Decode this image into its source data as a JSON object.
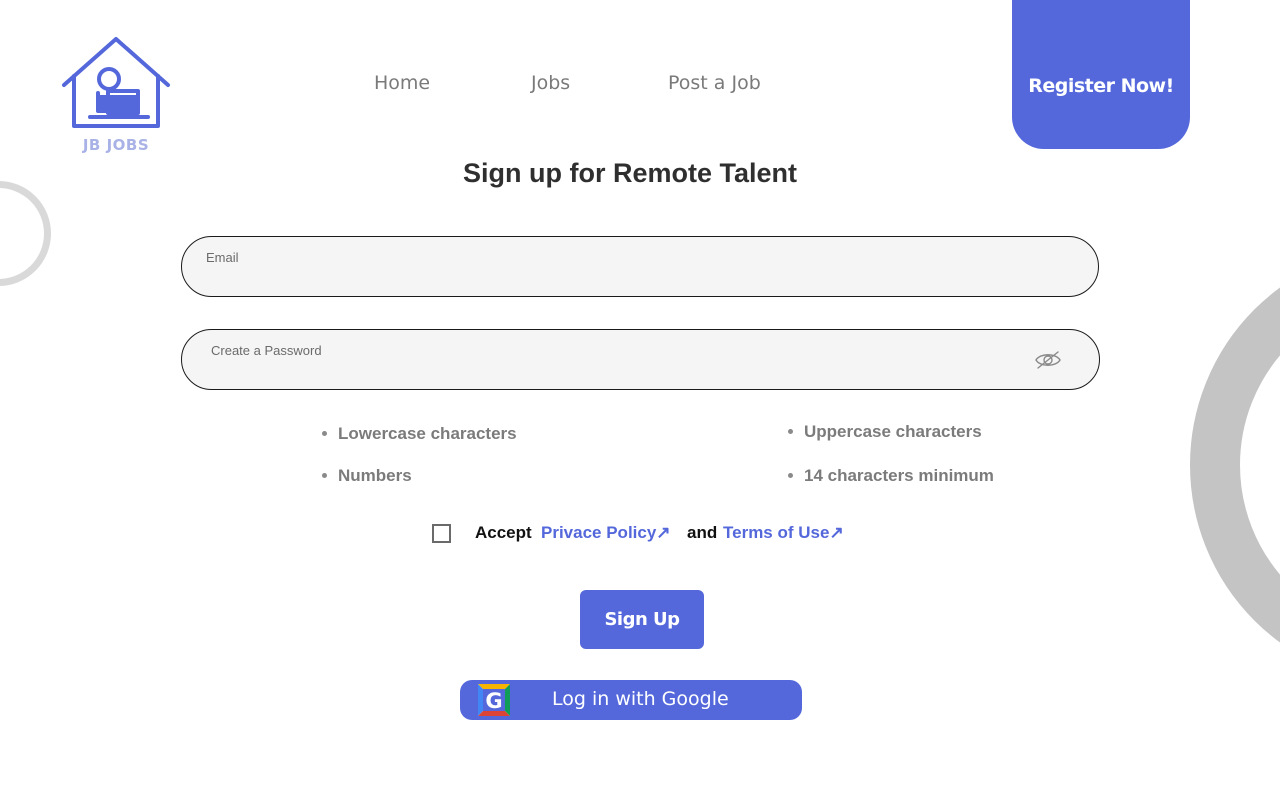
{
  "brand": {
    "logo_text": "JB JOBS",
    "accent_color": "#5468db"
  },
  "nav": {
    "items": [
      {
        "label": "Home"
      },
      {
        "label": "Jobs"
      },
      {
        "label": "Post a Job"
      }
    ],
    "register_label": "Register Now!"
  },
  "form": {
    "title": "Sign up for Remote Talent",
    "email": {
      "label": "Email",
      "value": ""
    },
    "password": {
      "label": "Create a Password",
      "value": "",
      "toggle_icon": "eye-slash-icon"
    },
    "requirements": [
      "Lowercase characters",
      "Uppercase characters",
      "Numbers",
      "14 characters minimum"
    ],
    "consent": {
      "checked": false,
      "accept_label": "Accept",
      "privacy_label": "Privace Policy↗",
      "and_label": "and",
      "terms_label": "Terms of Use↗"
    },
    "signup_label": "Sign Up",
    "google_label": "Log in with Google"
  }
}
